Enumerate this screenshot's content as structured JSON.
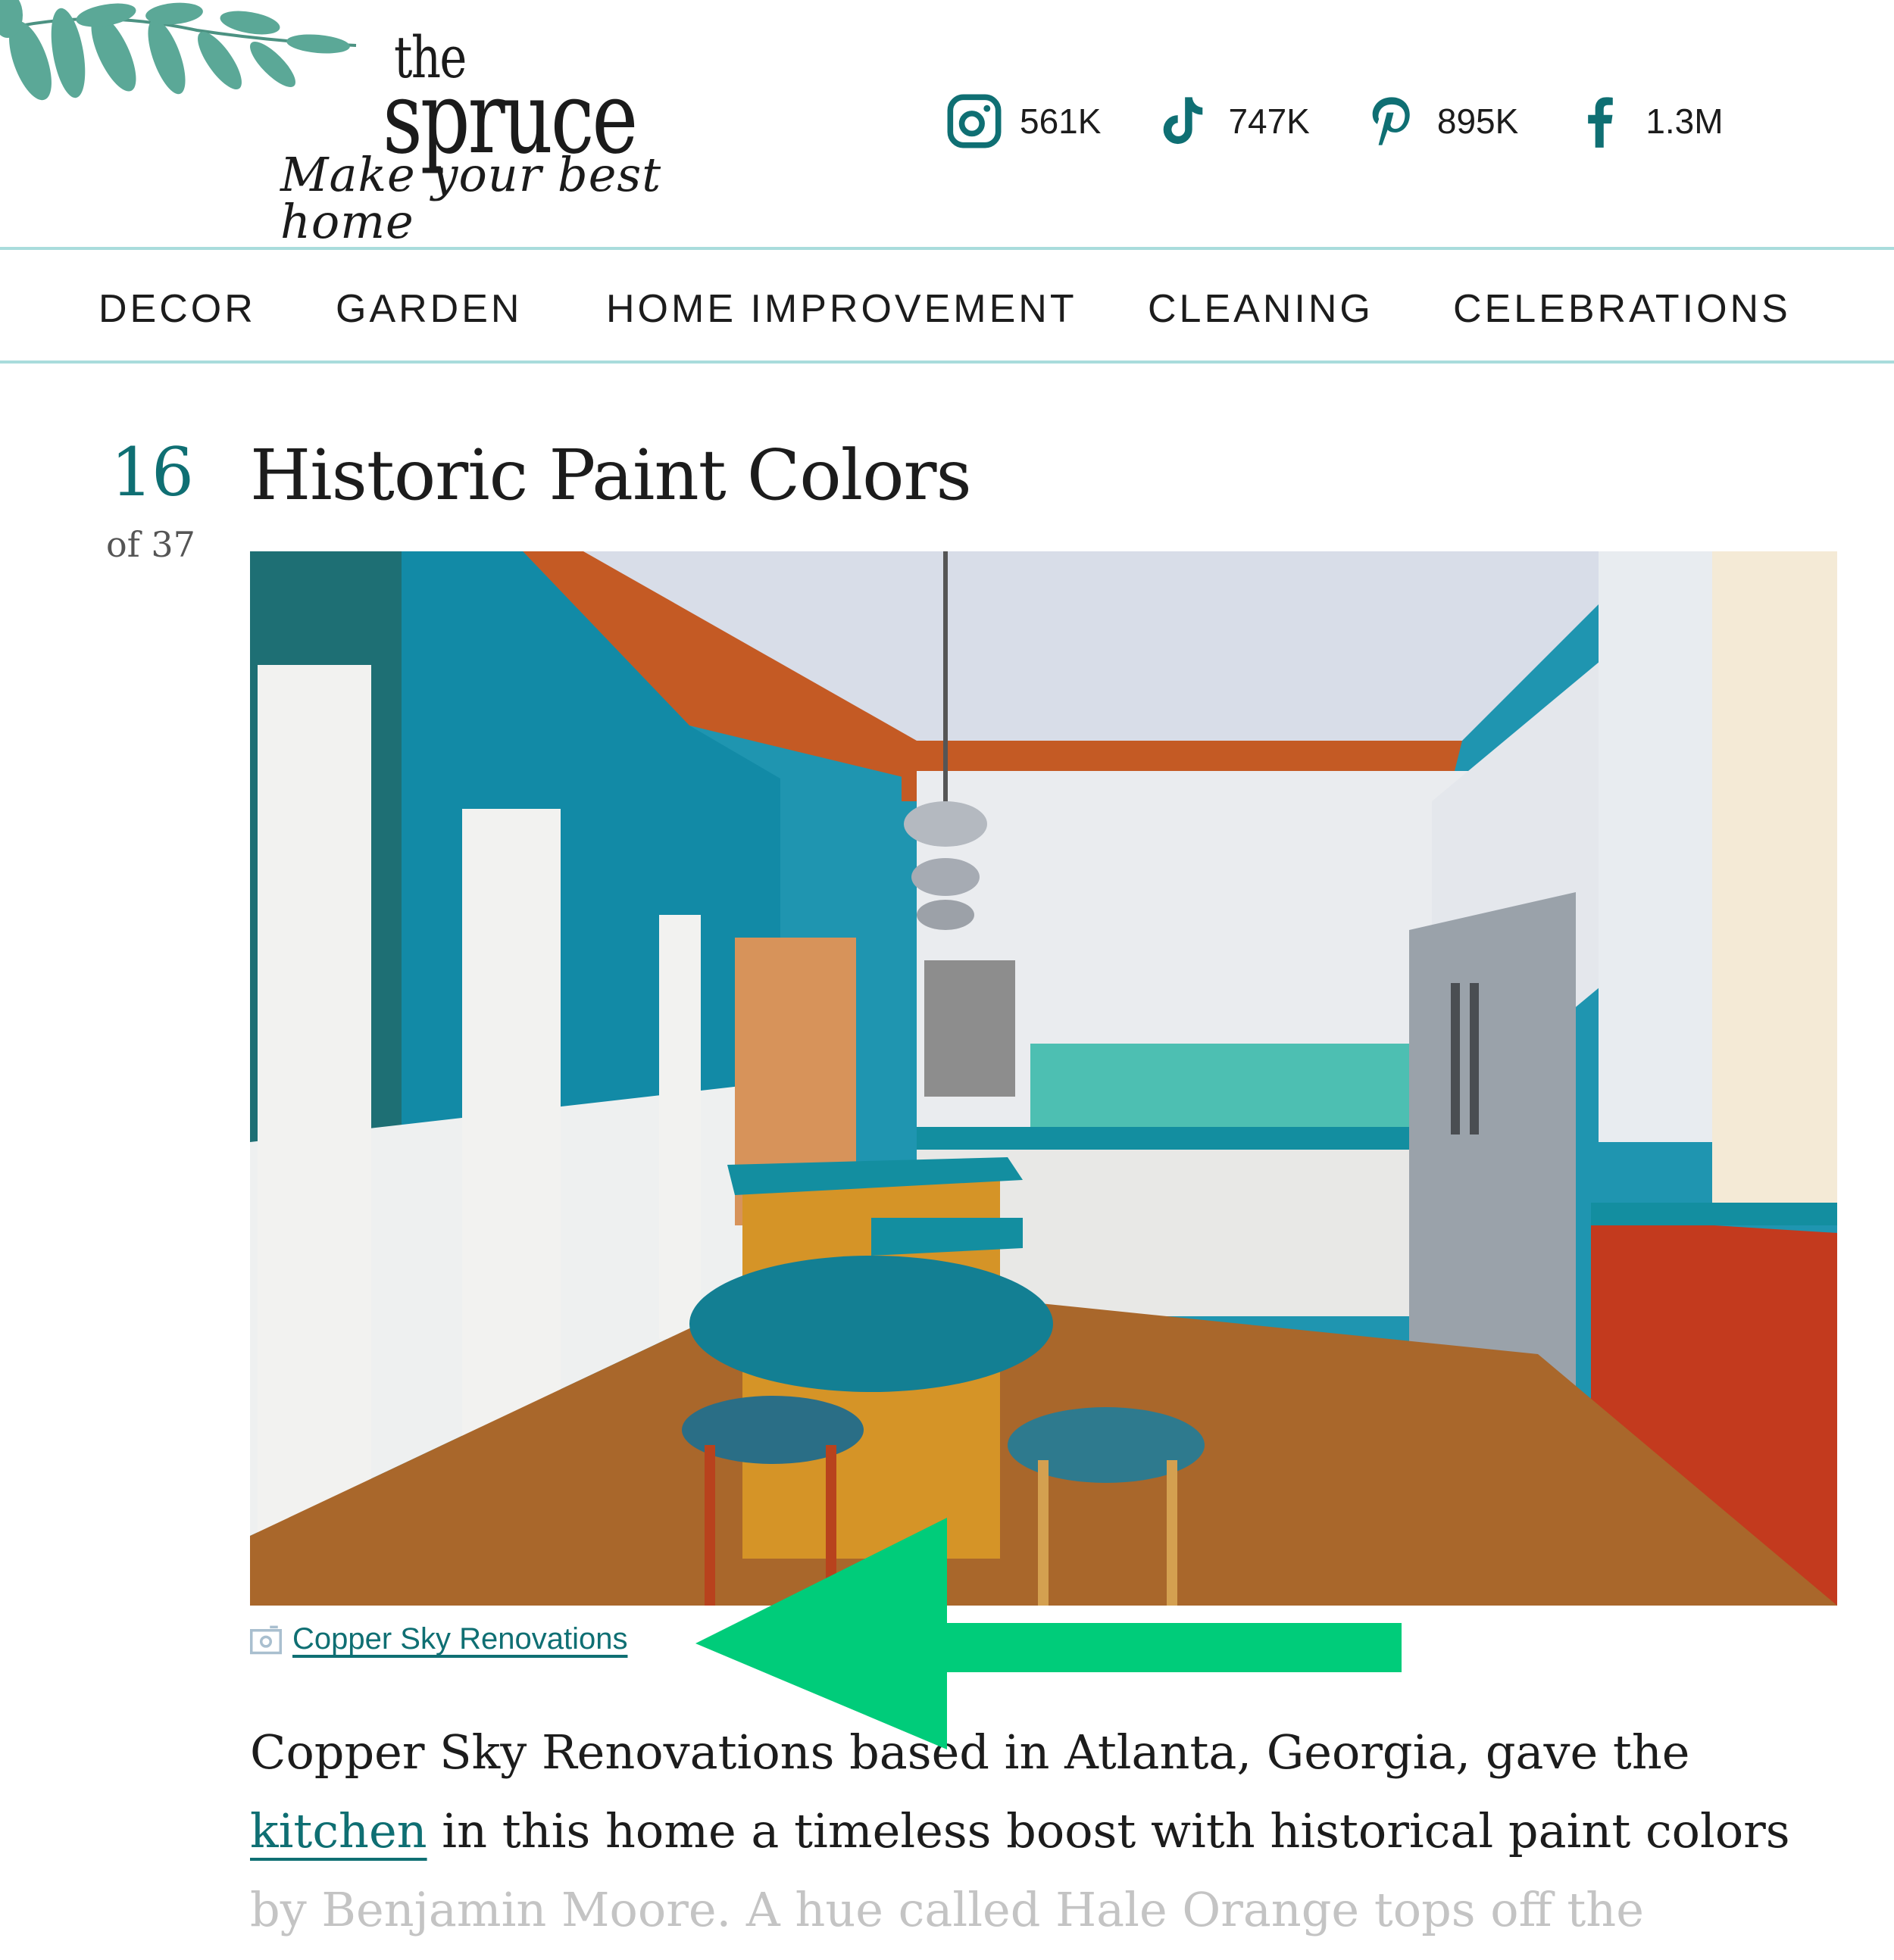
{
  "brand": {
    "name_top": "the",
    "name_main": "spruce",
    "tagline": "Make your best home"
  },
  "social": [
    {
      "network": "instagram",
      "icon": "instagram-icon",
      "count": "561K"
    },
    {
      "network": "tiktok",
      "icon": "tiktok-icon",
      "count": "747K"
    },
    {
      "network": "pinterest",
      "icon": "pinterest-icon",
      "count": "895K"
    },
    {
      "network": "facebook",
      "icon": "facebook-icon",
      "count": "1.3M"
    }
  ],
  "nav": {
    "items": [
      "DECOR",
      "GARDEN",
      "HOME IMPROVEMENT",
      "CLEANING",
      "CELEBRATIONS"
    ]
  },
  "article": {
    "item_number": "16",
    "item_total": "of 37",
    "title": "Historic Paint Colors",
    "image_alt": "Colorful kitchen with teal walls, orange trim, teal counters and a yellow island",
    "photo_credit_icon": "camera-icon",
    "photo_credit": "Copper Sky Renovations",
    "body": {
      "line1": "Copper Sky Renovations based in Atlanta, Georgia, gave the",
      "line2_link": "kitchen",
      "line2_rest": " in this home a timeless boost with historical paint colors",
      "line3": "by Benjamin Moore. A hue called Hale Orange tops off the"
    }
  },
  "annotation": {
    "type": "arrow",
    "color": "#00cc7a",
    "points_to": "photo-credit-link"
  },
  "colors": {
    "accent": "#0f6f73",
    "divider": "#a9dcdc",
    "text": "#1c1c1c"
  }
}
